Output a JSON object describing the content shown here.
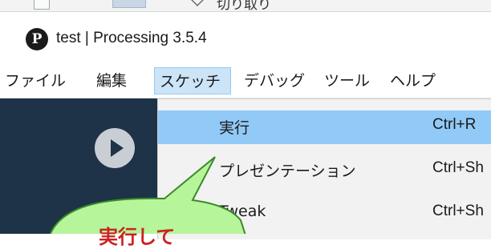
{
  "background_window": {
    "partial_text": "切り取り"
  },
  "window": {
    "logo_letter": "P",
    "title": "test | Processing 3.5.4"
  },
  "menubar": {
    "items": [
      {
        "label": "ファイル"
      },
      {
        "label": "編集"
      },
      {
        "label": "スケッチ"
      },
      {
        "label": "デバッグ"
      },
      {
        "label": "ツール"
      },
      {
        "label": "ヘルプ"
      }
    ],
    "active_item": "スケッチ"
  },
  "toolbar": {
    "run_icon": "play-icon"
  },
  "sketch_menu": {
    "items": [
      {
        "label": "実行",
        "shortcut": "Ctrl+R"
      },
      {
        "label": "プレゼンテーション",
        "shortcut": "Ctrl+Sh"
      },
      {
        "label": "Tweak",
        "shortcut": "Ctrl+Sh"
      }
    ],
    "highlighted_item": "実行"
  },
  "callout": {
    "text": "実行して"
  },
  "colors": {
    "menu_highlight": "#91c9f7",
    "toolbar_bg": "#1e3248",
    "callout_fill": "#b6f59a",
    "callout_text": "#cc2222"
  }
}
